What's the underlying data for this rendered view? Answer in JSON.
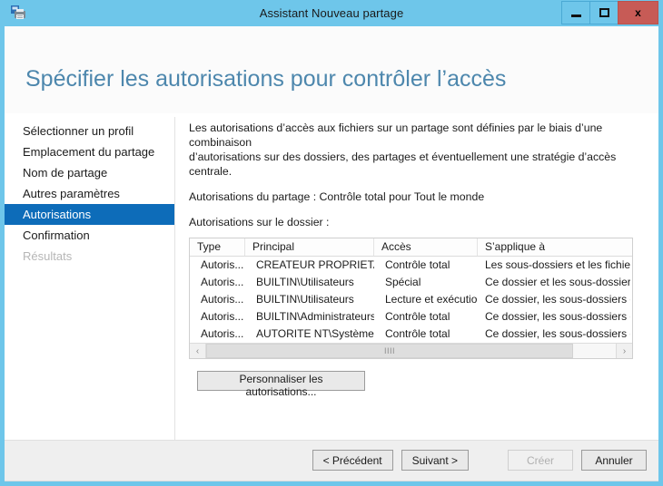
{
  "window": {
    "title": "Assistant Nouveau partage",
    "icon": "shared-folder-icon",
    "controls": {
      "minimize": "minimize-icon",
      "maximize": "maximize-icon",
      "close": "x"
    },
    "colors": {
      "border": "#6ec6ea",
      "titlebar": "#6ec6ea",
      "close_button": "#c75b56",
      "selection": "#0d6cb9",
      "heading": "#4d87ad"
    }
  },
  "page": {
    "heading": "Spécifier les autorisations pour contrôler l’accès"
  },
  "sidebar": {
    "items": [
      {
        "label": "Sélectionner un profil",
        "state": "normal"
      },
      {
        "label": "Emplacement du partage",
        "state": "normal"
      },
      {
        "label": "Nom de partage",
        "state": "normal"
      },
      {
        "label": "Autres paramètres",
        "state": "normal"
      },
      {
        "label": "Autorisations",
        "state": "selected"
      },
      {
        "label": "Confirmation",
        "state": "normal"
      },
      {
        "label": "Résultats",
        "state": "disabled"
      }
    ]
  },
  "main": {
    "description_line1": "Les autorisations d’accès aux fichiers sur un partage sont définies par le biais d’une combinaison",
    "description_line2": "d’autorisations sur des dossiers, des partages et éventuellement une stratégie d’accès centrale.",
    "share_permissions": "Autorisations du partage : Contrôle total pour Tout le monde",
    "folder_permissions_label": "Autorisations sur le dossier :",
    "customize_button": "Personnaliser les autorisations...",
    "table": {
      "columns": [
        "Type",
        "Principal",
        "Accès",
        "S’applique à"
      ],
      "rows": [
        {
          "type": "Autoris...",
          "principal": "CREATEUR PROPRIETAI...",
          "access": "Contrôle total",
          "applies_to": "Les sous-dossiers et les fichiers seu"
        },
        {
          "type": "Autoris...",
          "principal": "BUILTIN\\Utilisateurs",
          "access": "Spécial",
          "applies_to": "Ce dossier et les sous-dossiers"
        },
        {
          "type": "Autoris...",
          "principal": "BUILTIN\\Utilisateurs",
          "access": "Lecture et exécution",
          "applies_to": "Ce dossier, les sous-dossiers et les f"
        },
        {
          "type": "Autoris...",
          "principal": "BUILTIN\\Administrateurs",
          "access": "Contrôle total",
          "applies_to": "Ce dossier, les sous-dossiers et les f"
        },
        {
          "type": "Autoris...",
          "principal": "AUTORITE NT\\Système",
          "access": "Contrôle total",
          "applies_to": "Ce dossier, les sous-dossiers et les f"
        }
      ]
    },
    "scrollbar": {
      "left_arrow": "‹",
      "right_arrow": "›",
      "grip": "IIII"
    }
  },
  "footer": {
    "previous": "< Précédent",
    "next": "Suivant >",
    "create": "Créer",
    "cancel": "Annuler"
  }
}
